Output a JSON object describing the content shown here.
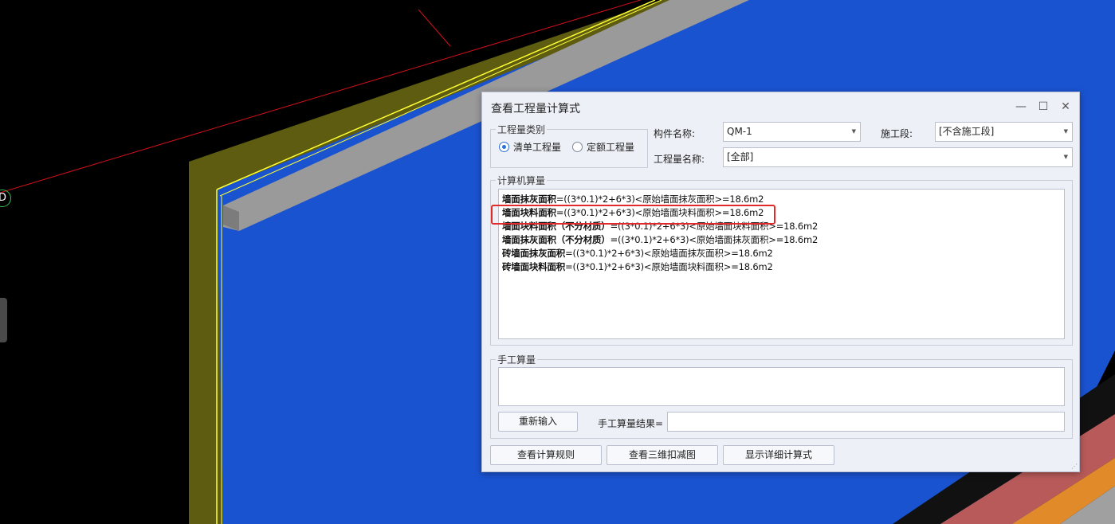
{
  "viewport": {
    "axis_marker_label": "D",
    "colors": {
      "background": "#000000",
      "wall_face": "#1a53d0",
      "wall_side": "#5e5c10",
      "wall_top": "#9a9a9a",
      "edge_highlight": "#ffff33",
      "grid_line": "#d0101a",
      "floor_stripe_red": "#b85a5a",
      "floor_stripe_orange": "#e08a2a"
    }
  },
  "dialog": {
    "title": "查看工程量计算式",
    "window_controls": {
      "minimize": "—",
      "maximize": "☐",
      "close": "✕"
    },
    "category_group": {
      "legend": "工程量类别",
      "options": [
        {
          "label": "清单工程量",
          "selected": true
        },
        {
          "label": "定额工程量",
          "selected": false
        }
      ]
    },
    "component_name": {
      "label": "构件名称:",
      "value": "QM-1"
    },
    "construction_stage": {
      "label": "施工段:",
      "value": "[不含施工段]"
    },
    "quantity_name": {
      "label": "工程量名称:",
      "value": "[全部]"
    },
    "computer_calc": {
      "legend": "计算机算量",
      "lines": [
        {
          "name": "墙面抹灰面积",
          "formula": "=((3*0.1)*2+6*3)<原始墙面抹灰面积>=18.6m2"
        },
        {
          "name": "墙面块料面积",
          "formula": "=((3*0.1)*2+6*3)<原始墙面块料面积>=18.6m2"
        },
        {
          "name": "墙面块料面积（不分材质）",
          "formula": "=((3*0.1)*2+6*3)<原始墙面块料面积>=18.6m2"
        },
        {
          "name": "墙面抹灰面积（不分材质）",
          "formula": "=((3*0.1)*2+6*3)<原始墙面抹灰面积>=18.6m2"
        },
        {
          "name": "砖墙面抹灰面积",
          "formula": "=((3*0.1)*2+6*3)<原始墙面抹灰面积>=18.6m2"
        },
        {
          "name": "砖墙面块料面积",
          "formula": "=((3*0.1)*2+6*3)<原始墙面块料面积>=18.6m2"
        }
      ]
    },
    "manual_calc": {
      "legend": "手工算量",
      "input_value": "",
      "reinput_label": "重新输入",
      "result_label": "手工算量结果=",
      "result_value": ""
    },
    "buttons": {
      "view_rules": "查看计算规则",
      "view_3d": "查看三维扣减图",
      "show_detail": "显示详细计算式"
    }
  }
}
